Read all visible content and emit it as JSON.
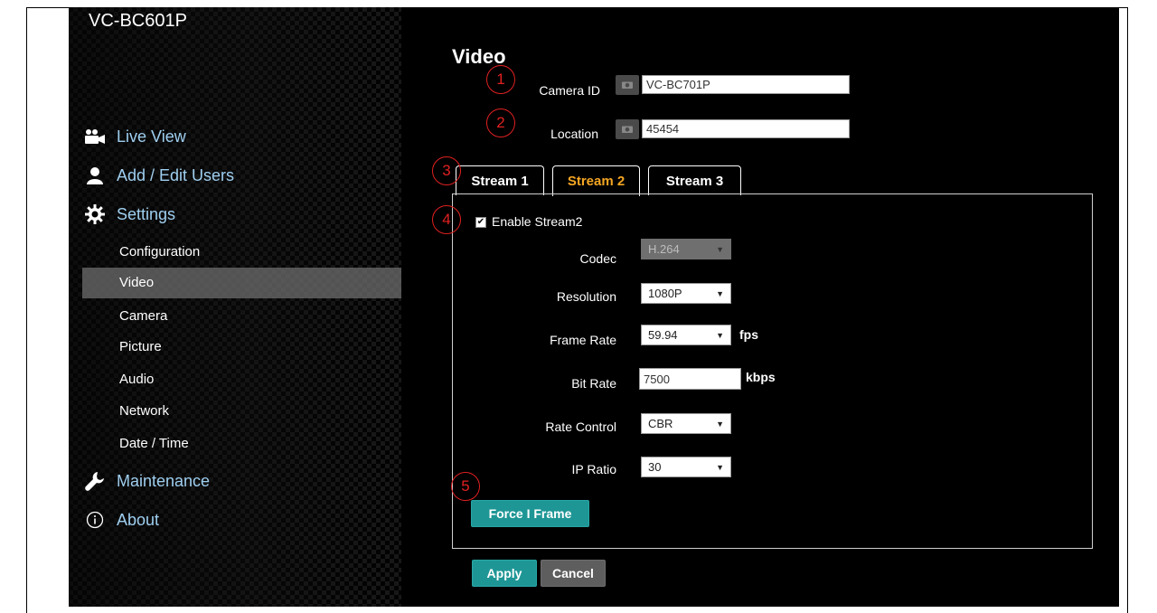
{
  "app": {
    "brand": "VC-BC601P"
  },
  "sidebar": {
    "live_view": "Live View",
    "add_edit_users": "Add / Edit Users",
    "settings": "Settings",
    "sub_items": [
      "Configuration",
      "Video",
      "Camera",
      "Picture",
      "Audio",
      "Network",
      "Date / Time"
    ],
    "active_sub_item": "Video",
    "maintenance": "Maintenance",
    "about": "About"
  },
  "main": {
    "page_title": "Video",
    "camera_id_label": "Camera ID",
    "camera_id_value": "VC-BC701P",
    "location_label": "Location",
    "location_value": "45454",
    "tabs": [
      "Stream 1",
      "Stream 2",
      "Stream 3"
    ],
    "active_tab": "Stream 2",
    "enable_label": "Enable Stream2",
    "enable_checked": true,
    "codec_label": "Codec",
    "codec_value": "H.264",
    "resolution_label": "Resolution",
    "resolution_value": "1080P",
    "frame_rate_label": "Frame Rate",
    "frame_rate_value": "59.94",
    "frame_rate_unit": "fps",
    "bit_rate_label": "Bit Rate",
    "bit_rate_value": "7500",
    "bit_rate_unit": "kbps",
    "rate_control_label": "Rate Control",
    "rate_control_value": "CBR",
    "ip_ratio_label": "IP Ratio",
    "ip_ratio_value": "30",
    "force_i_frame_label": "Force I Frame",
    "apply_label": "Apply",
    "cancel_label": "Cancel"
  },
  "callouts": [
    "1",
    "2",
    "3",
    "4",
    "5"
  ],
  "colors": {
    "accent_tab": "#f5a623",
    "nav_text": "#9fcff0",
    "button_teal": "#1f9696",
    "button_gray": "#5e5e5e",
    "callout_red": "#e02020"
  }
}
